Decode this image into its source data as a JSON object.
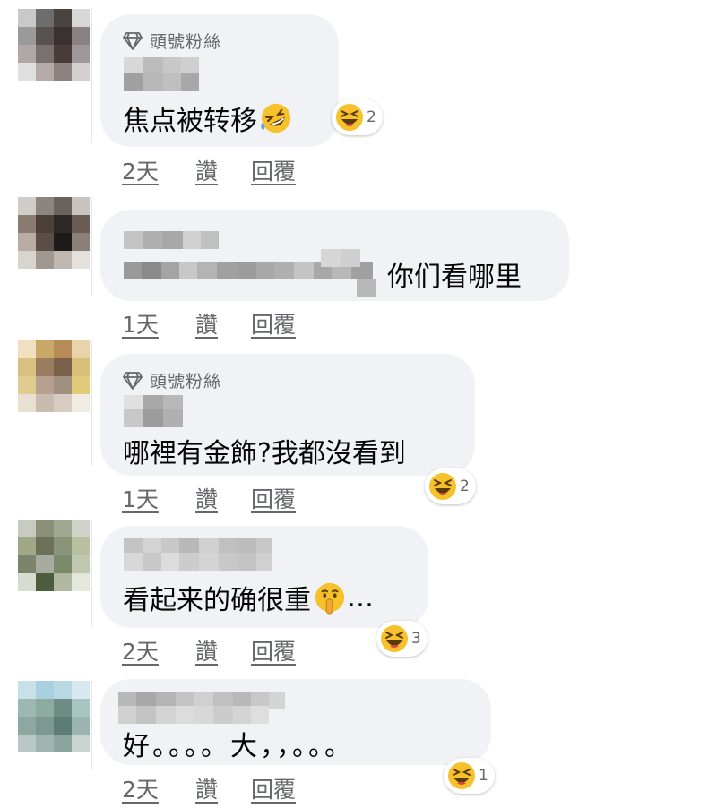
{
  "labels": {
    "like": "讚",
    "reply": "回覆"
  },
  "comments": [
    {
      "badge": "頭號粉絲",
      "text": "焦点被转移",
      "inline_emoji": "rofl",
      "reaction_emoji": "laugh",
      "reaction_count": "2",
      "time": "2天"
    },
    {
      "badge": "",
      "text": "你们看哪里",
      "inline_emoji": "",
      "reaction_emoji": "",
      "reaction_count": "",
      "time": "1天"
    },
    {
      "badge": "頭號粉絲",
      "text": "哪裡有金飾?我都沒看到",
      "inline_emoji": "",
      "reaction_emoji": "laugh",
      "reaction_count": "2",
      "time": "1天"
    },
    {
      "badge": "",
      "text": "看起来的确很重",
      "inline_emoji": "shushing",
      "text_after": "…",
      "reaction_emoji": "laugh",
      "reaction_count": "3",
      "time": "2天"
    },
    {
      "badge": "",
      "text": "好。。。。大，，。。。",
      "inline_emoji": "",
      "reaction_emoji": "laugh",
      "reaction_count": "1",
      "time": "2天"
    }
  ]
}
